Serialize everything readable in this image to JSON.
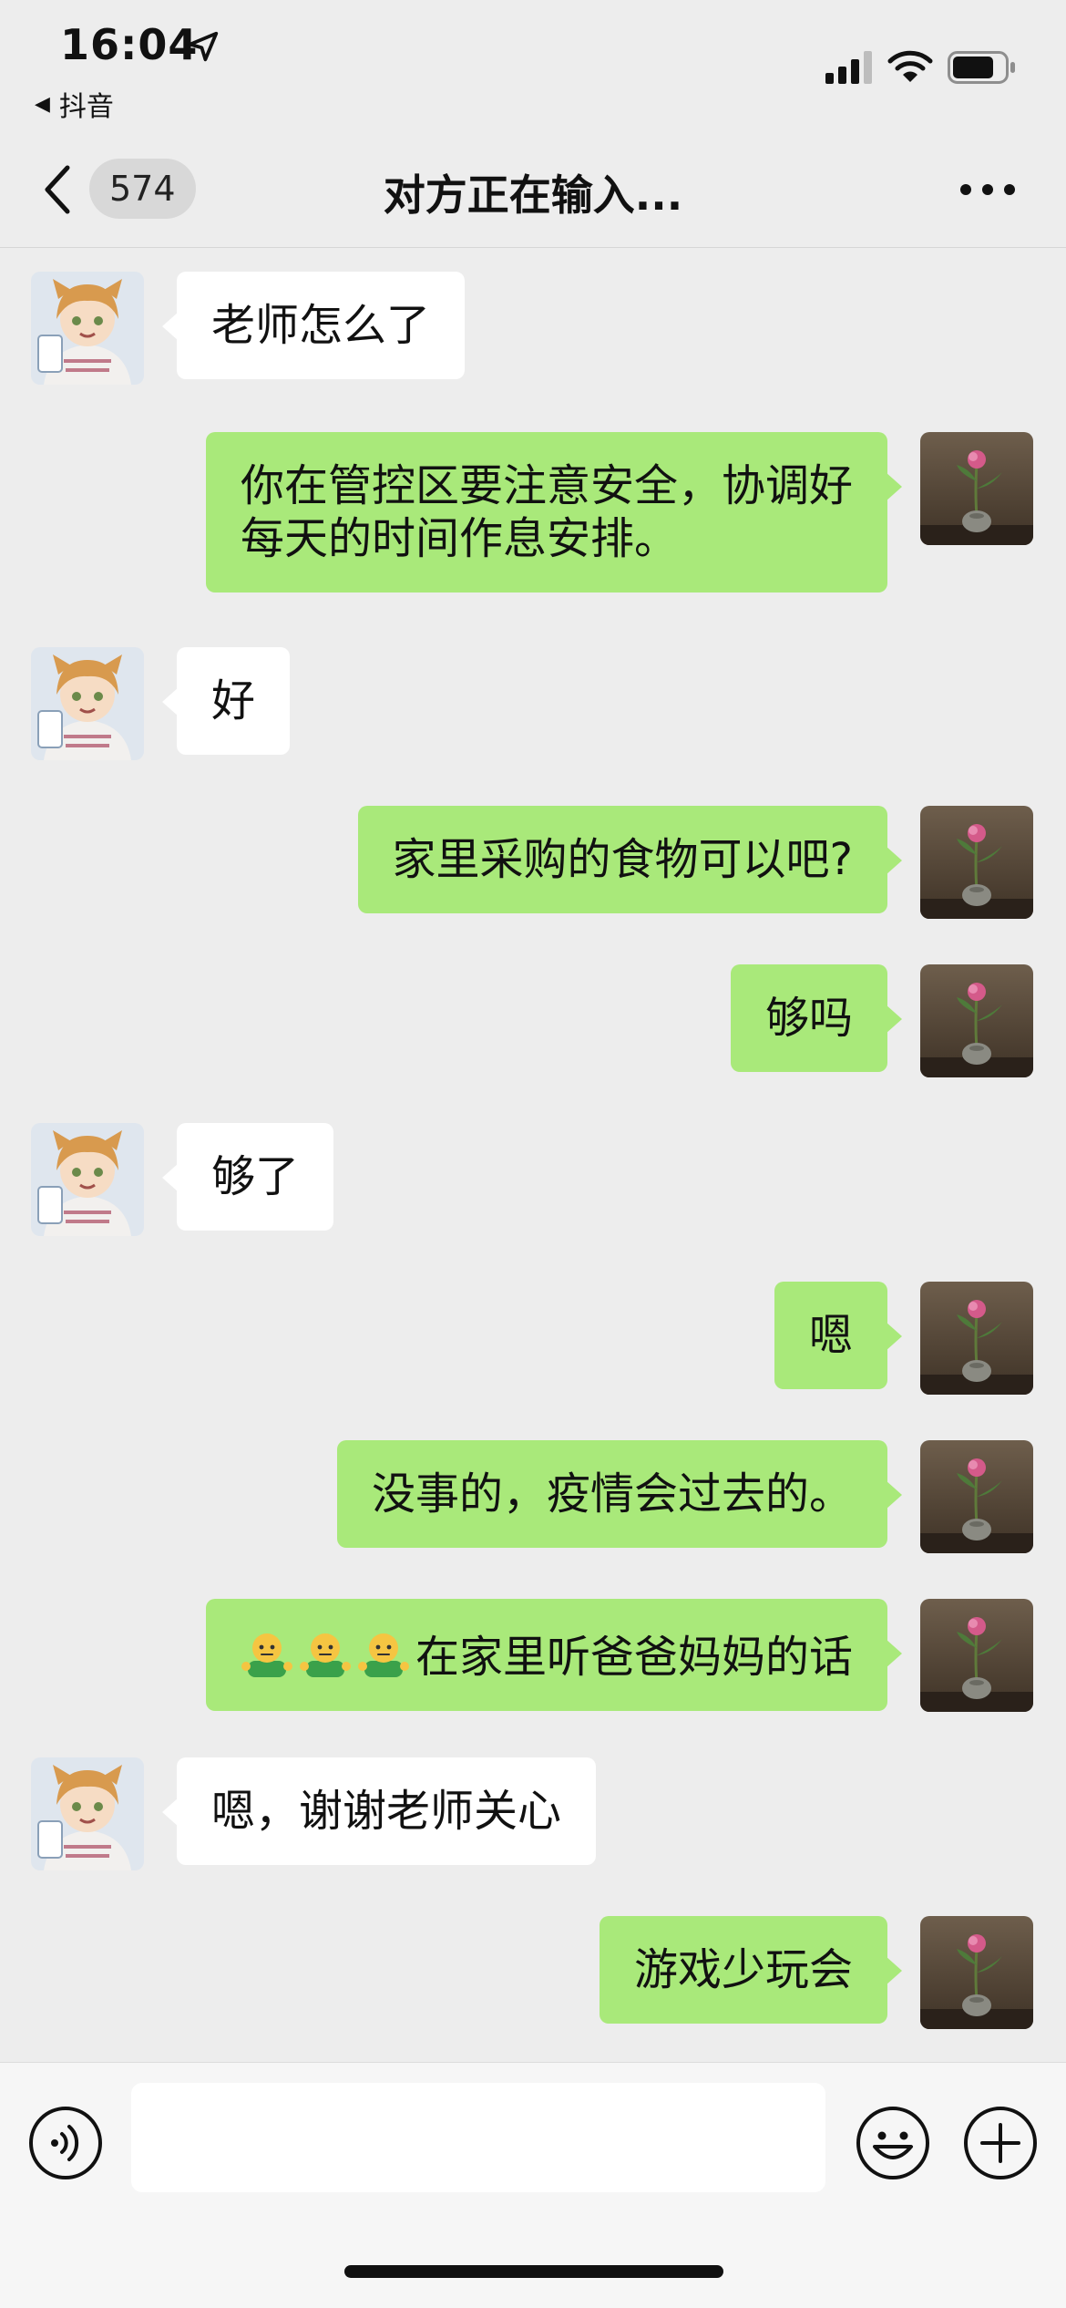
{
  "status_bar": {
    "time": "16:04",
    "back_app": "抖音",
    "icons": [
      "location-arrow-icon",
      "signal-icon",
      "wifi-icon",
      "battery-icon"
    ]
  },
  "nav": {
    "unread_count": "574",
    "title": "对方正在输入...",
    "icons": [
      "back-chevron-icon",
      "more-icon"
    ]
  },
  "messages": [
    {
      "side": "recv",
      "lines": [
        "老师怎么了"
      ]
    },
    {
      "side": "sent",
      "lines": [
        "你在管控区要注意安全，协调好",
        "每天的时间作息安排。"
      ]
    },
    {
      "side": "recv",
      "lines": [
        "好"
      ]
    },
    {
      "side": "sent",
      "lines": [
        "家里采购的食物可以吧?"
      ]
    },
    {
      "side": "sent",
      "lines": [
        "够吗"
      ]
    },
    {
      "side": "recv",
      "lines": [
        "够了"
      ]
    },
    {
      "side": "sent",
      "lines": [
        "嗯"
      ]
    },
    {
      "side": "sent",
      "lines": [
        "没事的，疫情会过去的。"
      ]
    },
    {
      "side": "sent",
      "emojis": 3,
      "emoji_icon": "shrugging-emoji-icon",
      "lines": [
        "在家里听爸爸妈妈的话"
      ]
    },
    {
      "side": "recv",
      "lines": [
        "嗯，谢谢老师关心"
      ]
    },
    {
      "side": "sent",
      "lines": [
        "游戏少玩会"
      ]
    }
  ],
  "input_bar": {
    "placeholder": "",
    "icons": [
      "voice-icon",
      "emoji-icon",
      "plus-icon"
    ]
  },
  "colors": {
    "background": "#ededed",
    "sent_bubble": "#a9e97a",
    "recv_bubble": "#ffffff",
    "input_bar": "#f6f6f6"
  }
}
